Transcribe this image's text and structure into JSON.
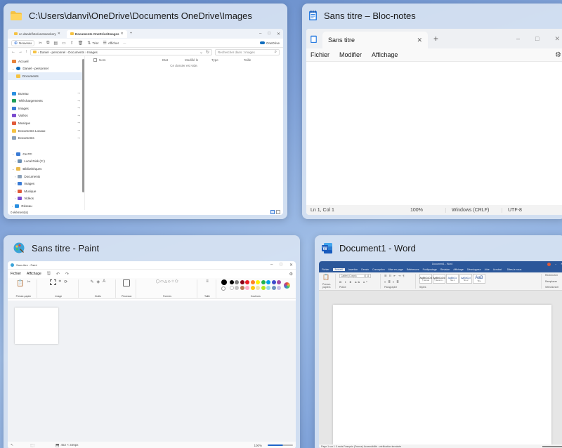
{
  "explorer": {
    "window_title": "C:\\Users\\danvi\\OneDrive\\Documents OneDrive\\Images",
    "tabs": [
      {
        "label": "cc-dandrifoto/unetweekery"
      },
      {
        "label": "Documents OneDrive\\Images"
      }
    ],
    "toolbar": {
      "new_label": "Nouveau",
      "sort_label": "Trier",
      "view_label": "Afficher",
      "more_label": "···",
      "onedrive_label": "OneDrive"
    },
    "address": "› Daniel - personnel › Documents › Images",
    "search_placeholder": "Rechercher dans : Images",
    "nav_items": [
      "Accueil",
      "Daniel - personnel",
      "Documents"
    ],
    "quick_access": [
      "Bureau",
      "Téléchargements",
      "Images",
      "Vidéos",
      "Musique",
      "Documents Locaux",
      "Documents"
    ],
    "pc_items": [
      "Ce PC",
      "Local Disk (C:)",
      "Bibliothèques",
      "Documents",
      "Images",
      "Musique",
      "Vidéos",
      "Réseau"
    ],
    "columns": [
      "Nom",
      "Etat",
      "Modifié le",
      "Type",
      "Taille"
    ],
    "empty_text": "Ce dossier est vide.",
    "status": "0 élément(s)"
  },
  "notepad": {
    "window_title": "Sans titre – Bloc-notes",
    "tab_label": "Sans titre",
    "menu": [
      "Fichier",
      "Modifier",
      "Affichage"
    ],
    "status": {
      "position": "Ln 1, Col 1",
      "zoom": "100%",
      "eol": "Windows (CRLF)",
      "encoding": "UTF-8"
    }
  },
  "paint": {
    "window_title": "Sans titre - Paint",
    "inner_title": "Sans titre - Paint",
    "menu": [
      "Fichier",
      "Affichage"
    ],
    "groups": [
      "Presse-papier",
      "Image",
      "Outils",
      "Pinceaux",
      "Formes",
      "Taille",
      "Couleurs"
    ],
    "status_size": "452 × 346px",
    "status_zoom": "100%",
    "palette": [
      "#000000",
      "#7f7f7f",
      "#880015",
      "#ed1c24",
      "#ff7f27",
      "#fff200",
      "#22b14c",
      "#00a2e8",
      "#3f48cc",
      "#a349a4",
      "#ffffff",
      "#c3c3c3",
      "#b97a57",
      "#ffaec9",
      "#ffc90e",
      "#efe4b0",
      "#b5e61d",
      "#99d9ea",
      "#7092be",
      "#c8bfe7"
    ]
  },
  "word": {
    "window_title": "Document1 - Word",
    "inner_title": "Document1 - Word",
    "tabs": [
      "Fichier",
      "Accueil",
      "Insertion",
      "Dessin",
      "Conception",
      "Mise en page",
      "Références",
      "Publipostage",
      "Révision",
      "Affichage",
      "Développeur",
      "Aide",
      "Acrobat"
    ],
    "tellme": "Dites-le-nous",
    "font_name": "Calibri (Corps)",
    "font_size": "11",
    "styles": [
      {
        "sample": "AaBbCcDd",
        "name": "¶ Normal"
      },
      {
        "sample": "AaBbCcDd",
        "name": "¶ Sans int..."
      },
      {
        "sample": "AaBbCc",
        "name": "Titre 1"
      },
      {
        "sample": "AaBbCcI",
        "name": "Titre 2"
      },
      {
        "sample": "AaB",
        "name": "Titre"
      }
    ],
    "group_labels": [
      "Presse-papiers",
      "Police",
      "Paragraphe",
      "Styles",
      "Édition"
    ],
    "editing": [
      "Rechercher",
      "Remplacer",
      "Sélectionner"
    ],
    "status": "Page 1 sur 1   0 mots   Français (France)   Accessibilité : vérification terminée"
  }
}
